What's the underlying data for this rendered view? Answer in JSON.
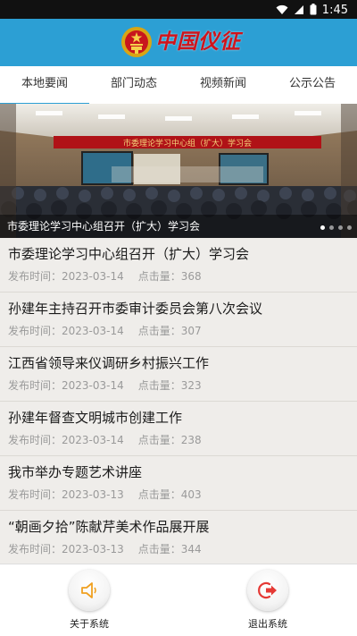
{
  "status": {
    "time": "1:45"
  },
  "app": {
    "title": "中国仪征"
  },
  "tabs": [
    {
      "label": "本地要闻",
      "active": true
    },
    {
      "label": "部门动态",
      "active": false
    },
    {
      "label": "视频新闻",
      "active": false
    },
    {
      "label": "公示公告",
      "active": false
    }
  ],
  "banner": {
    "caption": "市委理论学习中心组召开（扩大）学习会",
    "slide_count": 4,
    "active_slide": 1
  },
  "news": [
    {
      "title": "市委理论学习中心组召开（扩大）学习会",
      "date_label": "发布时间：",
      "date": "2023-03-14",
      "views_label": "点击量：",
      "views": "368"
    },
    {
      "title": "孙建年主持召开市委审计委员会第八次会议",
      "date_label": "发布时间：",
      "date": "2023-03-14",
      "views_label": "点击量：",
      "views": "307"
    },
    {
      "title": "江西省领导来仪调研乡村振兴工作",
      "date_label": "发布时间：",
      "date": "2023-03-14",
      "views_label": "点击量：",
      "views": "323"
    },
    {
      "title": "孙建年督查文明城市创建工作",
      "date_label": "发布时间：",
      "date": "2023-03-14",
      "views_label": "点击量：",
      "views": "238"
    },
    {
      "title": "我市举办专题艺术讲座",
      "date_label": "发布时间：",
      "date": "2023-03-13",
      "views_label": "点击量：",
      "views": "403"
    },
    {
      "title": "“朝画夕拾”陈献芹美术作品展开展",
      "date_label": "发布时间：",
      "date": "2023-03-13",
      "views_label": "点击量：",
      "views": "344"
    }
  ],
  "bottom": {
    "about_label": "关于系统",
    "exit_label": "退出系统"
  },
  "colors": {
    "accent": "#2c9fd4",
    "title_red": "#d0141b",
    "exit_red": "#e53935",
    "speaker_orange": "#f0a020"
  },
  "icons": [
    "wifi-icon",
    "signal-icon",
    "battery-icon",
    "national-emblem-icon",
    "speaker-icon",
    "exit-icon"
  ]
}
